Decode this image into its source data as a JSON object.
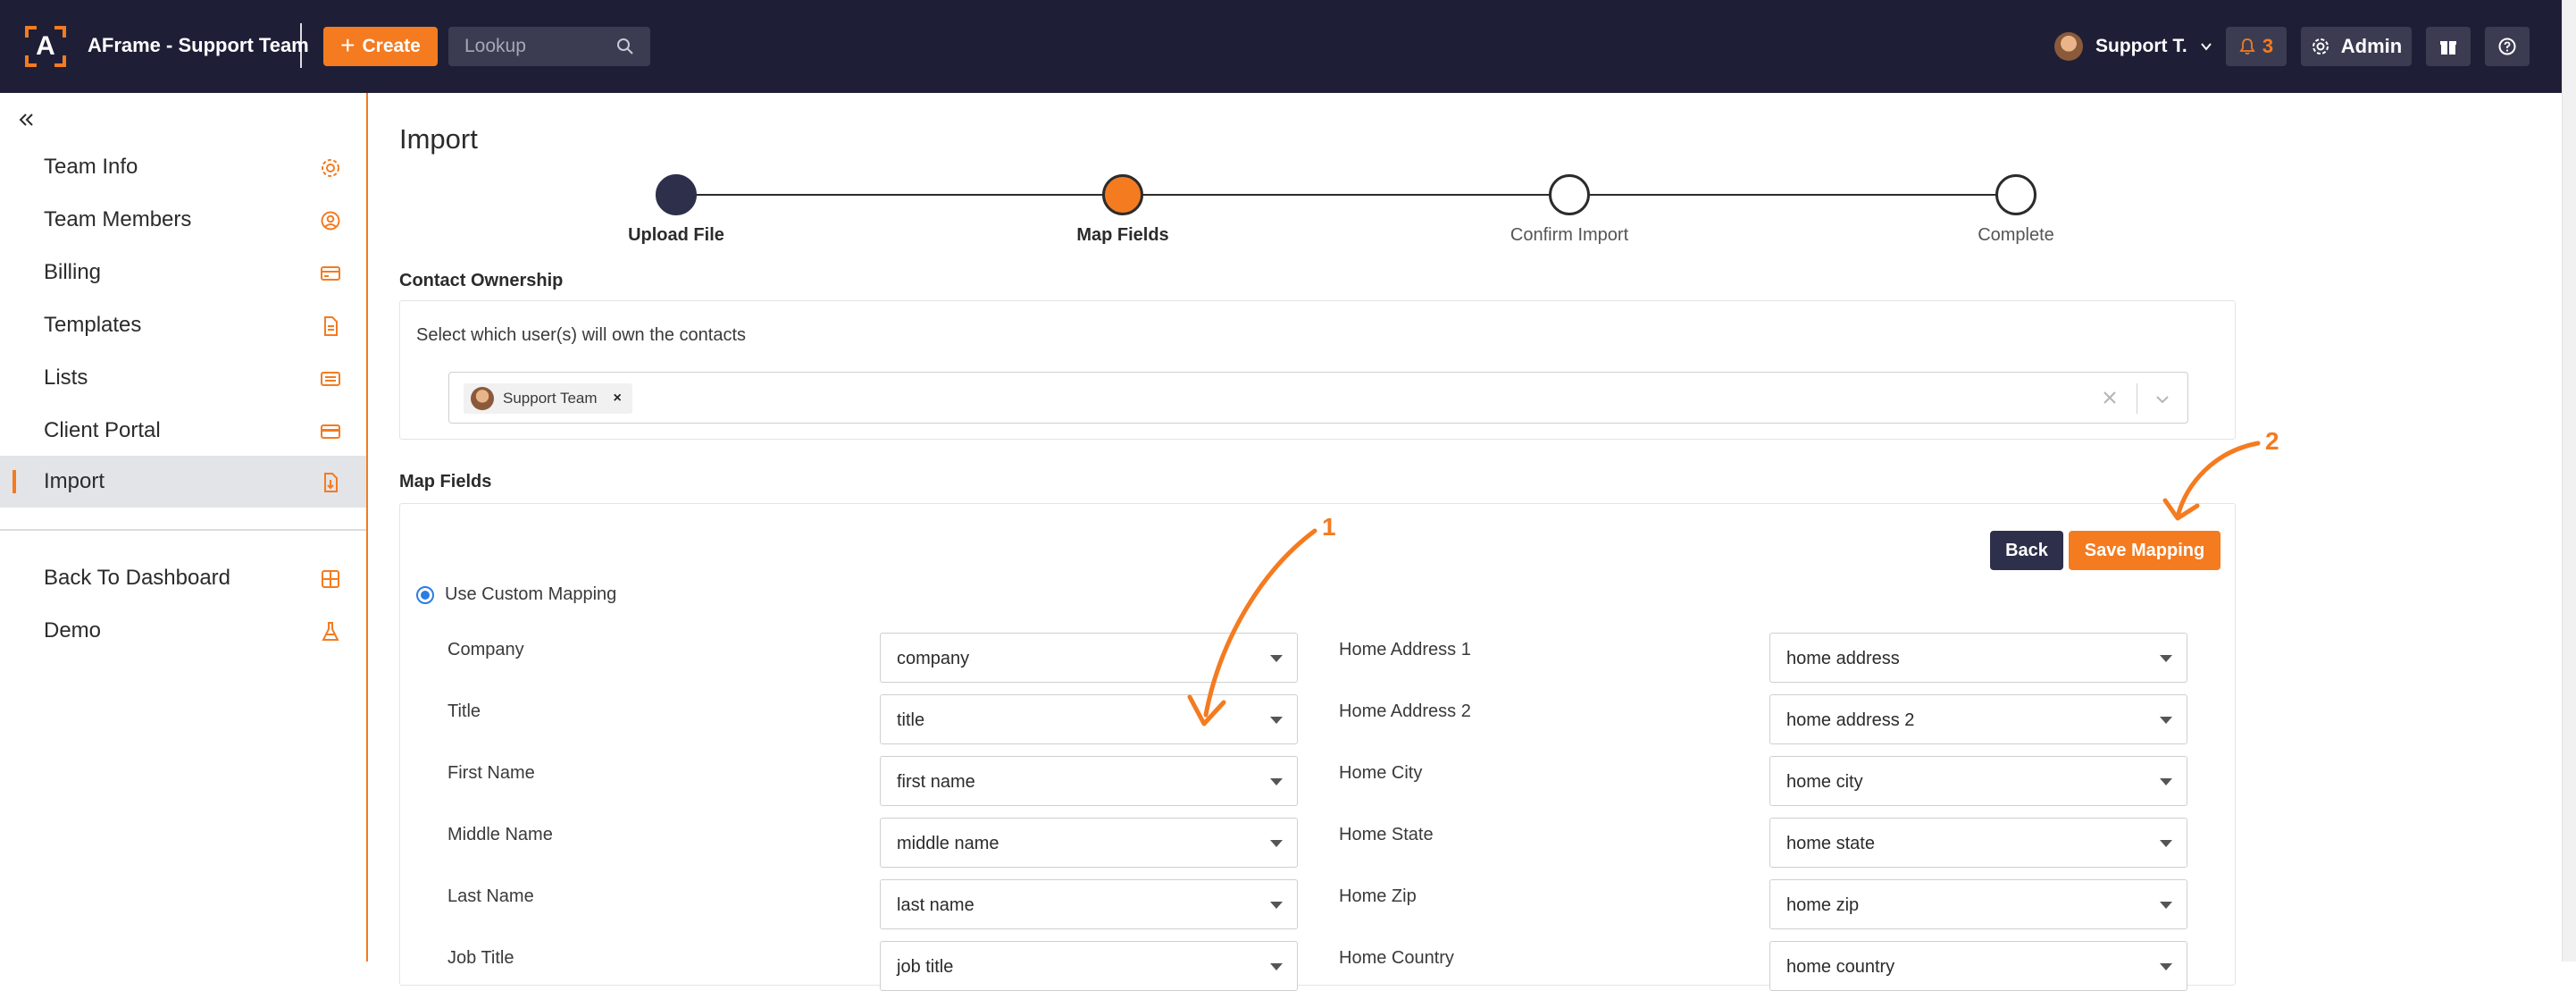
{
  "app": {
    "title": "AFrame - Support Team",
    "logo_letter": "A"
  },
  "topbar": {
    "create_label": "Create",
    "lookup_placeholder": "Lookup",
    "user_name": "Support T.",
    "notification_count": "3",
    "admin_label": "Admin"
  },
  "sidebar": {
    "items": [
      {
        "label": "Team Info",
        "icon": "gear-icon"
      },
      {
        "label": "Team Members",
        "icon": "user-circle-icon"
      },
      {
        "label": "Billing",
        "icon": "credit-card-icon"
      },
      {
        "label": "Templates",
        "icon": "document-icon"
      },
      {
        "label": "Lists",
        "icon": "list-icon"
      },
      {
        "label": "Client Portal",
        "icon": "card-icon"
      },
      {
        "label": "Import",
        "icon": "file-import-icon",
        "active": true
      }
    ],
    "secondary": [
      {
        "label": "Back To Dashboard",
        "icon": "grid-icon"
      },
      {
        "label": "Demo",
        "icon": "flask-icon"
      }
    ]
  },
  "page": {
    "title": "Import"
  },
  "stepper": [
    {
      "label": "Upload File",
      "state": "done"
    },
    {
      "label": "Map Fields",
      "state": "current"
    },
    {
      "label": "Confirm Import",
      "state": "todo"
    },
    {
      "label": "Complete",
      "state": "todo"
    }
  ],
  "ownership": {
    "heading": "Contact Ownership",
    "hint": "Select which user(s) will own the contacts",
    "selected_user": "Support Team"
  },
  "map_fields": {
    "heading": "Map Fields",
    "back_label": "Back",
    "save_label": "Save Mapping",
    "mode_label": "Use Custom Mapping",
    "left": [
      {
        "label": "Company",
        "value": "company"
      },
      {
        "label": "Title",
        "value": "title"
      },
      {
        "label": "First Name",
        "value": "first name"
      },
      {
        "label": "Middle Name",
        "value": "middle name"
      },
      {
        "label": "Last Name",
        "value": "last name"
      },
      {
        "label": "Job Title",
        "value": "job title"
      }
    ],
    "right": [
      {
        "label": "Home Address 1",
        "value": "home address"
      },
      {
        "label": "Home Address 2",
        "value": "home address 2"
      },
      {
        "label": "Home City",
        "value": "home city"
      },
      {
        "label": "Home State",
        "value": "home state"
      },
      {
        "label": "Home Zip",
        "value": "home zip"
      },
      {
        "label": "Home Country",
        "value": "home country"
      }
    ]
  },
  "annotations": {
    "one": "1",
    "two": "2"
  },
  "colors": {
    "accent": "#f47b20",
    "navy": "#1e1f36",
    "button_dark": "#2e2f4a"
  }
}
